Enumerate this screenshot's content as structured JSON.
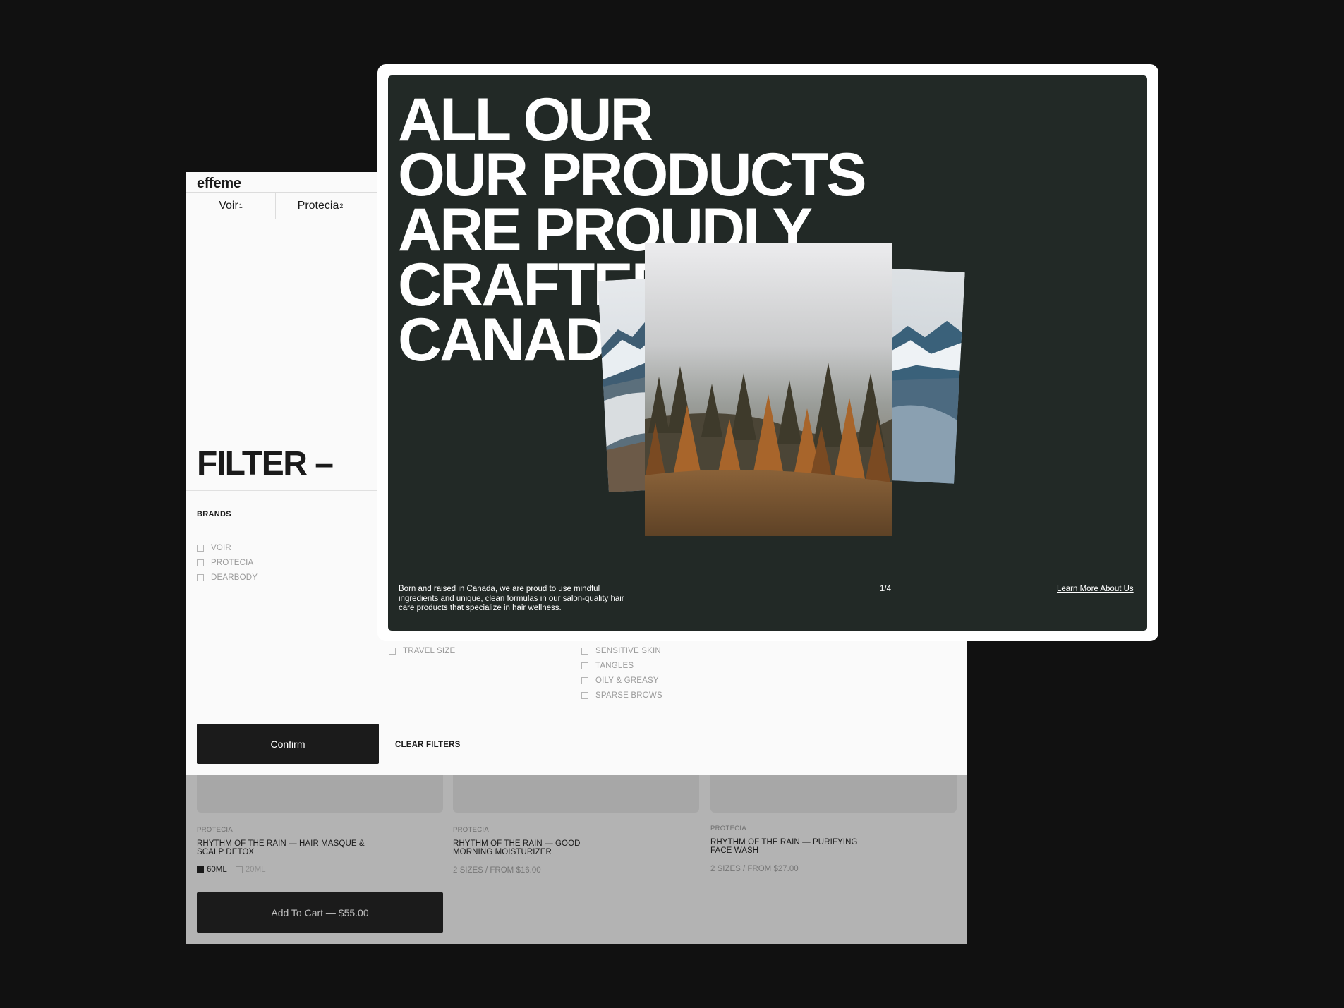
{
  "brand": {
    "logo": "effeme"
  },
  "nav": {
    "items": [
      {
        "label": "Voir",
        "sup": "1"
      },
      {
        "label": "Protecia",
        "sup": "2"
      }
    ]
  },
  "filter": {
    "title": "FILTER –",
    "brands_heading": "BRANDS",
    "brands": [
      "VOIR",
      "PROTECIA",
      "DEARBODY"
    ],
    "size_options": [
      "TRAVEL SIZE"
    ],
    "concern_options": [
      "SENSITIVE SKIN",
      "TANGLES",
      "OILY & GREASY",
      "SPARSE BROWS"
    ],
    "confirm_label": "Confirm",
    "clear_label": "CLEAR FILTERS"
  },
  "products": [
    {
      "brand": "PROTECIA",
      "name": "RHYTHM OF THE RAIN — HAIR MASQUE & SCALP DETOX",
      "sizes": [
        {
          "label": "60ML",
          "selected": true
        },
        {
          "label": "20ML",
          "selected": false
        }
      ],
      "cart_label": "Add To Cart — $55.00"
    },
    {
      "brand": "PROTECIA",
      "name": "RHYTHM OF THE RAIN — GOOD MORNING MOISTURIZER",
      "meta": "2 SIZES / FROM $16.00"
    },
    {
      "brand": "PROTECIA",
      "name": "RHYTHM OF THE RAIN — PURIFYING FACE WASH",
      "meta": "2 SIZES / FROM $27.00"
    }
  ],
  "hero": {
    "headline_lines": [
      "ALL OUR",
      "OUR PRODUCTS",
      "ARE PROUDLY",
      "CRAFTED IN",
      "CANADA"
    ],
    "description": "Born and raised in Canada, we are proud to use mindful ingredients and unique, clean formulas in our salon-quality hair care products that specialize in hair wellness.",
    "counter": "1/4",
    "link_label": "Learn More About Us"
  },
  "colors": {
    "background": "#111111",
    "hero_bg": "#222926",
    "button_dark": "#1b1b1b",
    "panel_bg": "#fafafa"
  }
}
